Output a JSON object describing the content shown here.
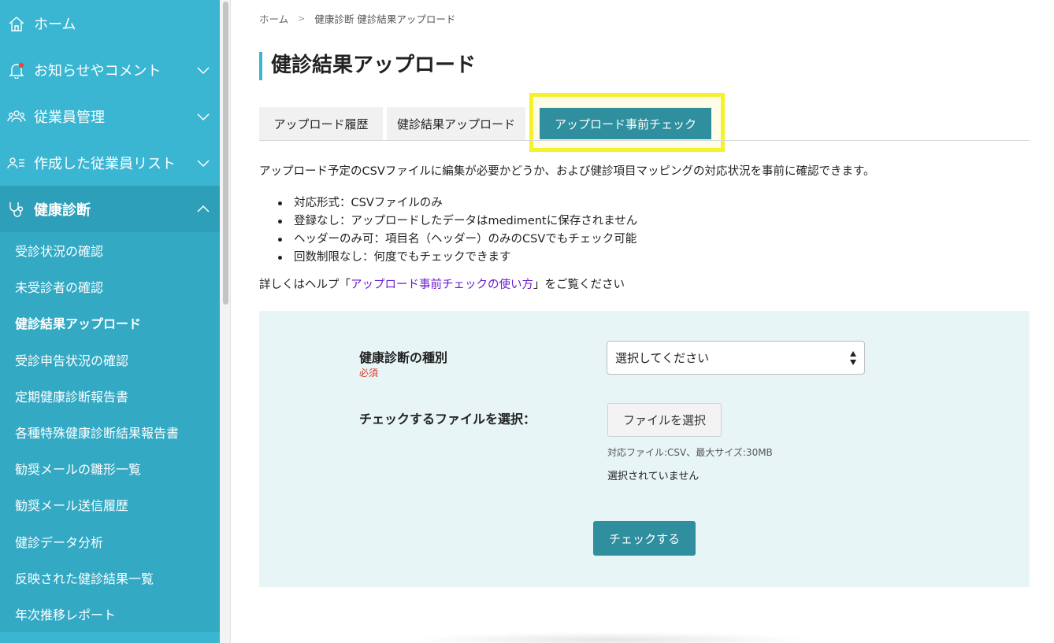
{
  "sidebar": {
    "home": {
      "label": "ホーム",
      "icon": "home-icon"
    },
    "notifications": {
      "label": "お知らせやコメント",
      "icon": "bell-icon",
      "has_badge": true,
      "badge_color": "#e8483b"
    },
    "employees": {
      "label": "従業員管理",
      "icon": "people-icon"
    },
    "lists": {
      "label": "作成した従業員リスト",
      "icon": "user-list-icon"
    },
    "checkup": {
      "label": "健康診断",
      "icon": "stethoscope-icon",
      "expanded": true,
      "items": [
        {
          "label": "受診状況の確認"
        },
        {
          "label": "未受診者の確認"
        },
        {
          "label": "健診結果アップロード",
          "current": true
        },
        {
          "label": "受診申告状況の確認"
        },
        {
          "label": "定期健康診断報告書"
        },
        {
          "label": "各種特殊健康診断結果報告書"
        },
        {
          "label": "勧奨メールの雛形一覧"
        },
        {
          "label": "勧奨メール送信履歴"
        },
        {
          "label": "健診データ分析"
        },
        {
          "label": "反映された健診結果一覧"
        },
        {
          "label": "年次推移レポート"
        }
      ]
    }
  },
  "breadcrumb": {
    "home": "ホーム",
    "separator": ">",
    "current": "健康診断 健診結果アップロード"
  },
  "page_title": "健診結果アップロード",
  "tabs": [
    {
      "label": "アップロード履歴",
      "active": false
    },
    {
      "label": "健診結果アップロード",
      "active": false
    },
    {
      "label": "アップロード事前チェック",
      "active": true
    }
  ],
  "description": "アップロード予定のCSVファイルに編集が必要かどうか、および健診項目マッピングの対応状況を事前に確認できます。",
  "bullets": [
    "対応形式：CSVファイルのみ",
    "登録なし：アップロードしたデータはmedimentに保存されません",
    "ヘッダーのみ可：項目名（ヘッダー）のみのCSVでもチェック可能",
    "回数制限なし：何度でもチェックできます"
  ],
  "help": {
    "prefix": "詳しくはヘルプ「",
    "link": "アップロード事前チェックの使い方",
    "suffix": "」をご覧ください"
  },
  "form": {
    "type_label": "健康診断の種別",
    "required_label": "必須",
    "select_value": "選択してください",
    "file_label": "チェックするファイルを選択：",
    "file_button": "ファイルを選択",
    "file_note": "対応ファイル:CSV、最大サイズ:30MB",
    "file_status": "選択されていません",
    "submit_button": "チェックする"
  },
  "colors": {
    "sidebar": "#3ab6d2",
    "sidebar_active": "#2e9fb8",
    "accent_button": "#2f8f9f",
    "highlight": "#f5f22c",
    "link": "#6a1bd1",
    "required": "#e0392b",
    "panel": "#e8f5f6"
  }
}
